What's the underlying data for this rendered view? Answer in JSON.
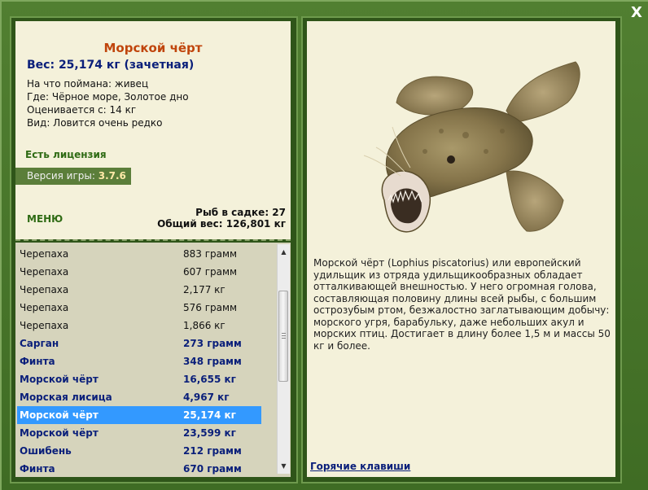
{
  "window": {
    "close_label": "X"
  },
  "fish": {
    "name": "Морской чёрт",
    "weight_line": "Вес: 25,174 кг (зачетная)",
    "caught_on": "На что поймана: живец",
    "location": "Где: Чёрное море, Золотое дно",
    "valued_from": "Оценивается с: 14 кг",
    "rarity": "Вид: Ловится очень редко"
  },
  "license": "Есть лицензия",
  "version": {
    "label": "Версия игры: ",
    "value": "3.7.6"
  },
  "menu_label": "МЕНЮ",
  "stats": {
    "fish_in_keepnet": "Рыб в садке: 27",
    "total_weight": "Общий вес: 126,801 кг"
  },
  "catch_list": [
    {
      "name": "Черепаха",
      "weight": "883 грамм",
      "style": "normal"
    },
    {
      "name": "Черепаха",
      "weight": "607 грамм",
      "style": "normal"
    },
    {
      "name": "Черепаха",
      "weight": "2,177 кг",
      "style": "normal"
    },
    {
      "name": "Черепаха",
      "weight": "576 грамм",
      "style": "normal"
    },
    {
      "name": "Черепаха",
      "weight": "1,866 кг",
      "style": "normal"
    },
    {
      "name": "Сарган",
      "weight": "273 грамм",
      "style": "bold"
    },
    {
      "name": "Финта",
      "weight": "348 грамм",
      "style": "bold"
    },
    {
      "name": "Морской чёрт",
      "weight": "16,655 кг",
      "style": "bold"
    },
    {
      "name": "Морская лисица",
      "weight": "4,967 кг",
      "style": "bold"
    },
    {
      "name": "Морской чёрт",
      "weight": "25,174 кг",
      "style": "bold",
      "selected": true
    },
    {
      "name": "Морской чёрт",
      "weight": "23,599 кг",
      "style": "bold"
    },
    {
      "name": "Ошибень",
      "weight": "212 грамм",
      "style": "bold"
    },
    {
      "name": "Финта",
      "weight": "670 грамм",
      "style": "bold"
    }
  ],
  "description": "Морской чёрт (Lophius piscatorius) или европейский удильщик из отряда удильщикообразных обладает отталкивающей внешностью. У него огромная голова, составляющая половину длины всей рыбы, с большим острозубым ртом, безжалостно заглатывающим добычу: морского угря, барабульку, даже небольших акул и морских птиц. Достигает в длину более 1,5 м и массы 50 кг и более.",
  "hotkeys_label": "Горячие клавиши",
  "colors": {
    "accent_title": "#c0450c",
    "bold_text": "#0a1f7a",
    "selection": "#3399ff",
    "frame_green": "#4a7a2c"
  }
}
